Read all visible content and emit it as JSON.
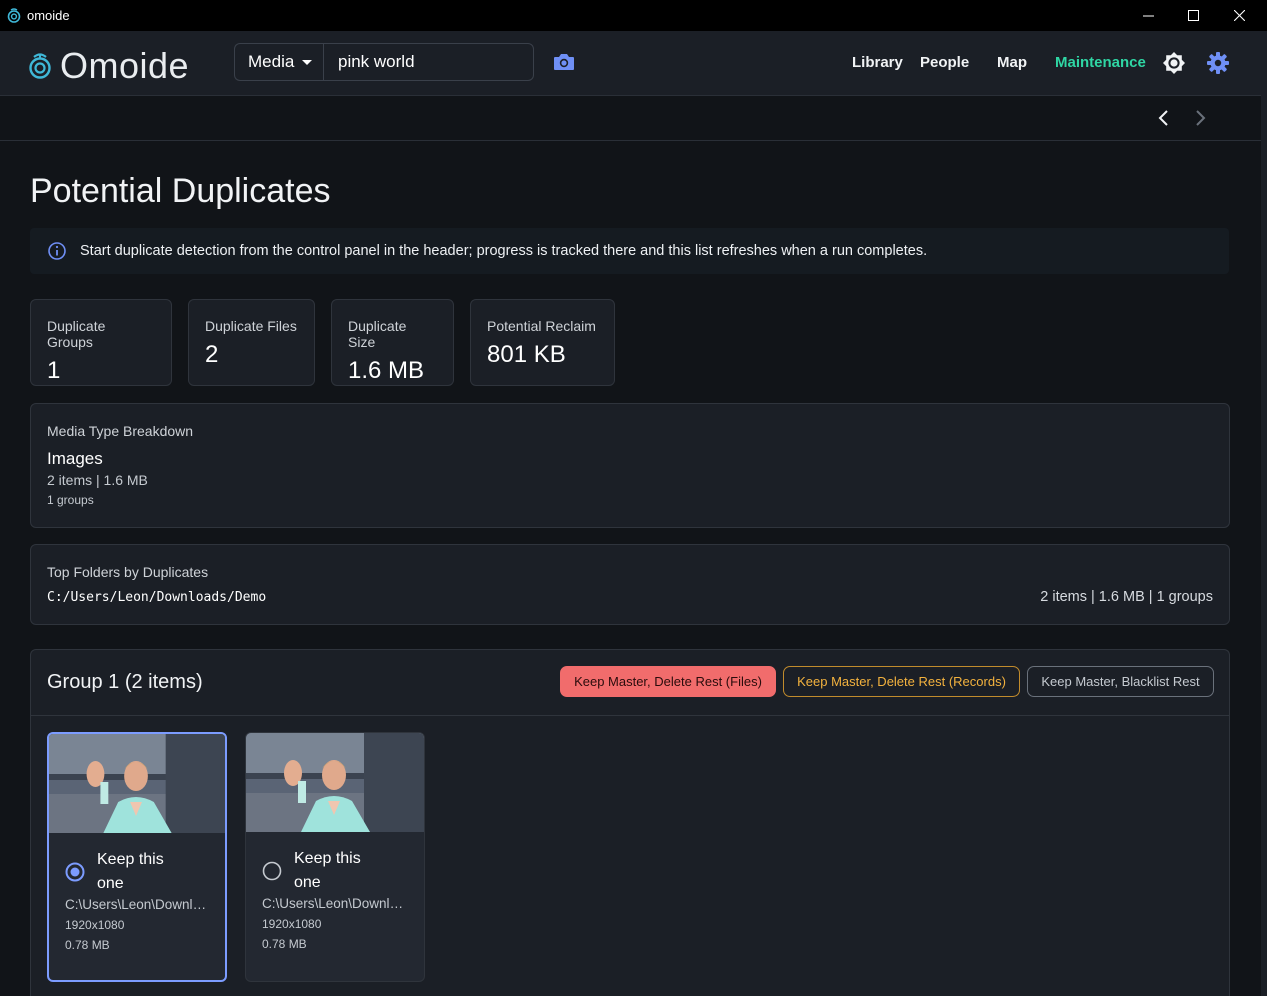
{
  "window": {
    "title": "omoide"
  },
  "header": {
    "brand": "Omoide",
    "media_select": "Media",
    "search_value": "pink world",
    "nav": [
      "Library",
      "People",
      "Map",
      "Maintenance"
    ],
    "active_nav": "Maintenance",
    "accent_color": "#2fd6a4"
  },
  "page": {
    "title": "Potential Duplicates",
    "info": "Start duplicate detection from the control panel in the header; progress is tracked there and this list refreshes when a run completes."
  },
  "stats": [
    {
      "label": "Duplicate Groups",
      "value": "1"
    },
    {
      "label": "Duplicate Files",
      "value": "2"
    },
    {
      "label": "Duplicate Size",
      "value": "1.6 MB"
    },
    {
      "label": "Potential Reclaim",
      "value": "801 KB"
    }
  ],
  "media_breakdown": {
    "label": "Media Type Breakdown",
    "type": "Images",
    "summary": "2 items | 1.6 MB",
    "groups": "1 groups"
  },
  "top_folders": {
    "label": "Top Folders by Duplicates",
    "path": "C:/Users/Leon/Downloads/Demo",
    "stats": "2 items | 1.6 MB | 1 groups"
  },
  "group": {
    "title": "Group 1 (2 items)",
    "actions": {
      "delete_files": "Keep Master, Delete Rest (Files)",
      "delete_records": "Keep Master, Delete Rest (Records)",
      "blacklist": "Keep Master, Blacklist Rest"
    },
    "items": [
      {
        "keep_label": "Keep this one",
        "path": "C:\\Users\\Leon\\Downloads\\Demo\\pink-world.jpg",
        "dims": "1920x1080",
        "size": "0.78 MB",
        "selected": true
      },
      {
        "keep_label": "Keep this one",
        "path": "C:\\Users\\Leon\\Downloads\\Demo\\pink-world.jpg",
        "dims": "1920x1080",
        "size": "0.78 MB",
        "selected": false
      }
    ]
  },
  "icons": {
    "app": "omoide-logo-icon",
    "camera": "camera-icon",
    "theme": "brightness-icon",
    "settings": "gear-icon",
    "info": "info-icon",
    "back": "chevron-left-icon",
    "forward": "chevron-right-icon"
  }
}
